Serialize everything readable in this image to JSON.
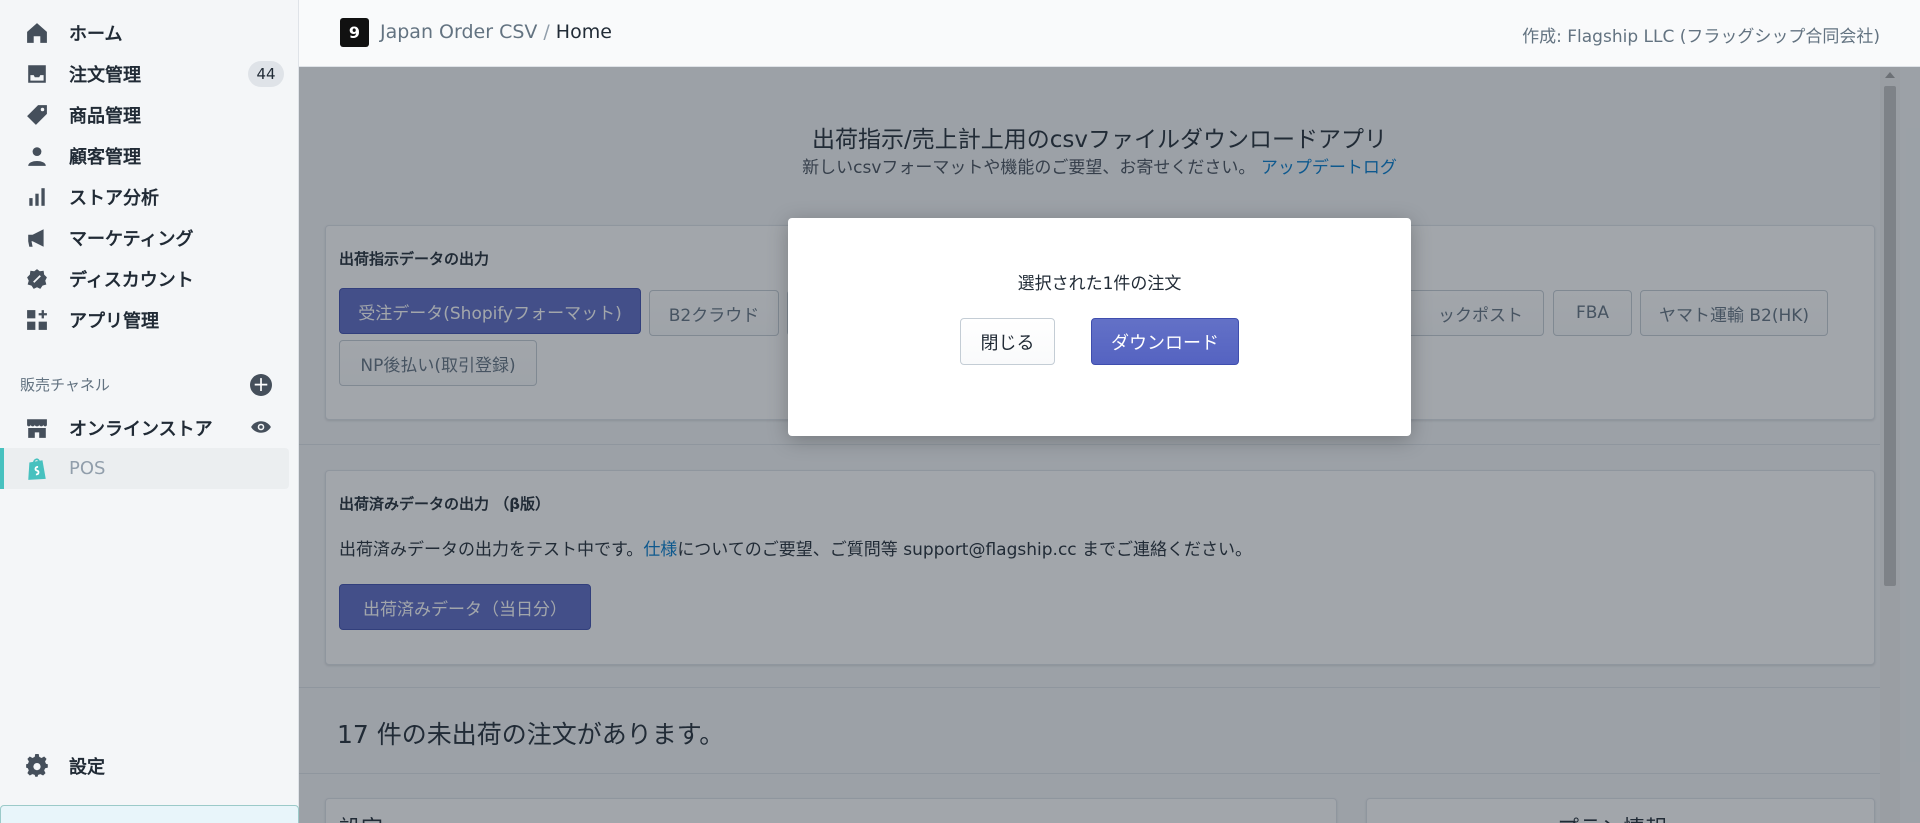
{
  "sidebar": {
    "items": [
      {
        "label": "ホーム",
        "icon": "home-icon"
      },
      {
        "label": "注文管理",
        "icon": "orders-icon",
        "badge": "44"
      },
      {
        "label": "商品管理",
        "icon": "tag-icon"
      },
      {
        "label": "顧客管理",
        "icon": "person-icon"
      },
      {
        "label": "ストア分析",
        "icon": "bar-chart-icon"
      },
      {
        "label": "マーケティング",
        "icon": "megaphone-icon"
      },
      {
        "label": "ディスカウント",
        "icon": "discount-icon"
      },
      {
        "label": "アプリ管理",
        "icon": "apps-icon"
      }
    ],
    "channels_label": "販売チャネル",
    "channels": [
      {
        "label": "オンラインストア",
        "icon": "store-icon"
      },
      {
        "label": "POS",
        "icon": "shopify-bag-icon"
      }
    ],
    "settings_label": "設定"
  },
  "topbar": {
    "app_name": "Japan Order CSV",
    "separator": "/",
    "current": "Home",
    "credit": "作成: Flagship LLC (フラッグシップ合同会社)"
  },
  "header": {
    "title": "出荷指示/売上計上用のcsvファイルダウンロードアプリ",
    "subtitle": "新しいcsvフォーマットや機能のご要望、お寄せください。",
    "update_log": "アップデートログ"
  },
  "shipping_card": {
    "title": "出荷指示データの出力",
    "buttons_row1": [
      "受注データ(Shopifyフォーマット)",
      "B2クラウド",
      "",
      "ックポスト",
      "FBA",
      "ヤマト運輸 B2(HK)"
    ],
    "buttons_row2": [
      "NP後払い(取引登録)"
    ]
  },
  "shipped_card": {
    "title": "出荷済みデータの出力 （β版）",
    "text_before": "出荷済みデータの出力をテスト中です。",
    "spec_link": "仕様",
    "text_after": "についてのご要望、ご質問等 support@flagship.cc までご連絡ください。",
    "button": "出荷済みデータ（当日分）"
  },
  "unshipped": "17 件の未出荷の注文があります。",
  "lower_cards": {
    "left": "設定",
    "right": "プラン情報"
  },
  "modal": {
    "message": "選択された1件の注文",
    "close": "閉じる",
    "download": "ダウンロード"
  },
  "colors": {
    "primary": "#5c6ac4",
    "link": "#007ace",
    "pos_accent": "#47c1bf"
  }
}
